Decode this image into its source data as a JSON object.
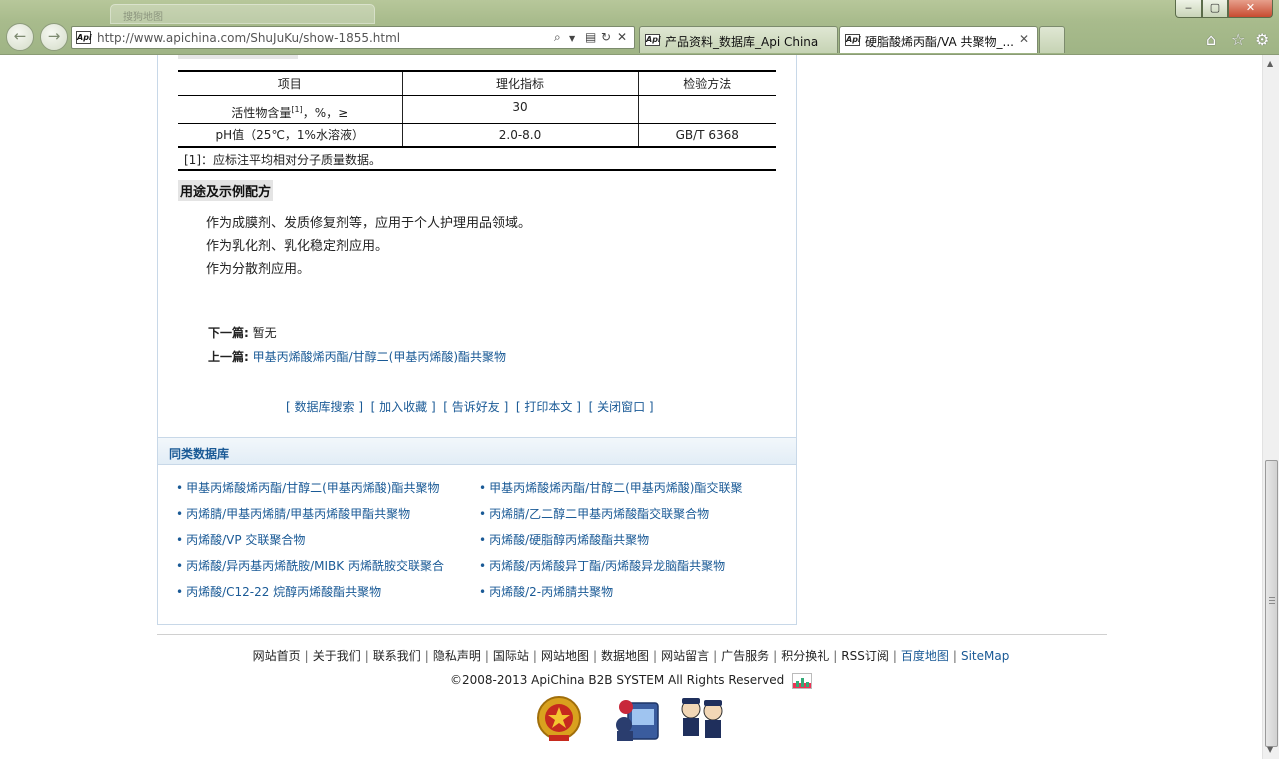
{
  "browser": {
    "bg_tab_title": "搜狗地图",
    "url": "http://www.apichina.com/ShuJuKu/show-1855.html",
    "tabs": [
      {
        "label": "产品资料_数据库_Api China",
        "favicon": "Api"
      },
      {
        "label": "硬脂酸烯丙酯/VA 共聚物_...",
        "favicon": "Api"
      }
    ],
    "icons": [
      "back-icon",
      "forward-icon",
      "search-icon",
      "compat-icon",
      "refresh-icon",
      "stop-icon",
      "home-icon",
      "favorites-star-icon",
      "tools-gear-icon"
    ]
  },
  "spec_table": {
    "headers": [
      "项目",
      "理化指标",
      "检验方法"
    ],
    "rows": [
      {
        "item": "活性物含量",
        "sup": "[1]",
        "item_suffix": "，%，≥",
        "value": "30",
        "method": ""
      },
      {
        "item": "pH值（25℃，1%水溶液）",
        "sup": "",
        "item_suffix": "",
        "value": "2.0-8.0",
        "method": "GB/T 6368"
      }
    ],
    "footnote": "[1]：应标注平均相对分子质量数据。"
  },
  "usage": {
    "title": "用途及示例配方",
    "lines": [
      "作为成膜剂、发质修复剂等，应用于个人护理用品领域。",
      "作为乳化剂、乳化稳定剂应用。",
      "作为分散剂应用。"
    ]
  },
  "nav": {
    "next_label": "下一篇:",
    "next_value": "暂无",
    "prev_label": "上一篇:",
    "prev_value": "甲基丙烯酸烯丙酯/甘醇二(甲基丙烯酸)酯共聚物"
  },
  "actions": [
    "数据库搜索",
    "加入收藏",
    "告诉好友",
    "打印本文",
    "关闭窗口"
  ],
  "related": {
    "title": "同类数据库",
    "items": [
      "甲基丙烯酸烯丙酯/甘醇二(甲基丙烯酸)酯共聚物",
      "甲基丙烯酸烯丙酯/甘醇二(甲基丙烯酸)酯交联聚",
      "丙烯腈/甲基丙烯腈/甲基丙烯酸甲酯共聚物",
      "丙烯腈/乙二醇二甲基丙烯酸酯交联聚合物",
      "丙烯酸/VP 交联聚合物",
      "丙烯酸/硬脂醇丙烯酸酯共聚物",
      "丙烯酸/异丙基丙烯酰胺/MIBK 丙烯酰胺交联聚合",
      "丙烯酸/丙烯酸异丁酯/丙烯酸异龙脑酯共聚物",
      "丙烯酸/C12-22 烷醇丙烯酸酯共聚物",
      "丙烯酸/2-丙烯腈共聚物"
    ]
  },
  "footer": {
    "links": [
      "网站首页",
      "关于我们",
      "联系我们",
      "隐私声明",
      "国际站",
      "网站地图",
      "数据地图",
      "网站留言",
      "广告服务",
      "积分换礼",
      "RSS订阅",
      "百度地图",
      "SiteMap"
    ],
    "copyright": "©2008-2013 ApiChina B2B SYSTEM All Rights Reserved",
    "badges": [
      "police-emblem-icon",
      "cyber-police-icon",
      "police-cartoon-icon"
    ]
  }
}
